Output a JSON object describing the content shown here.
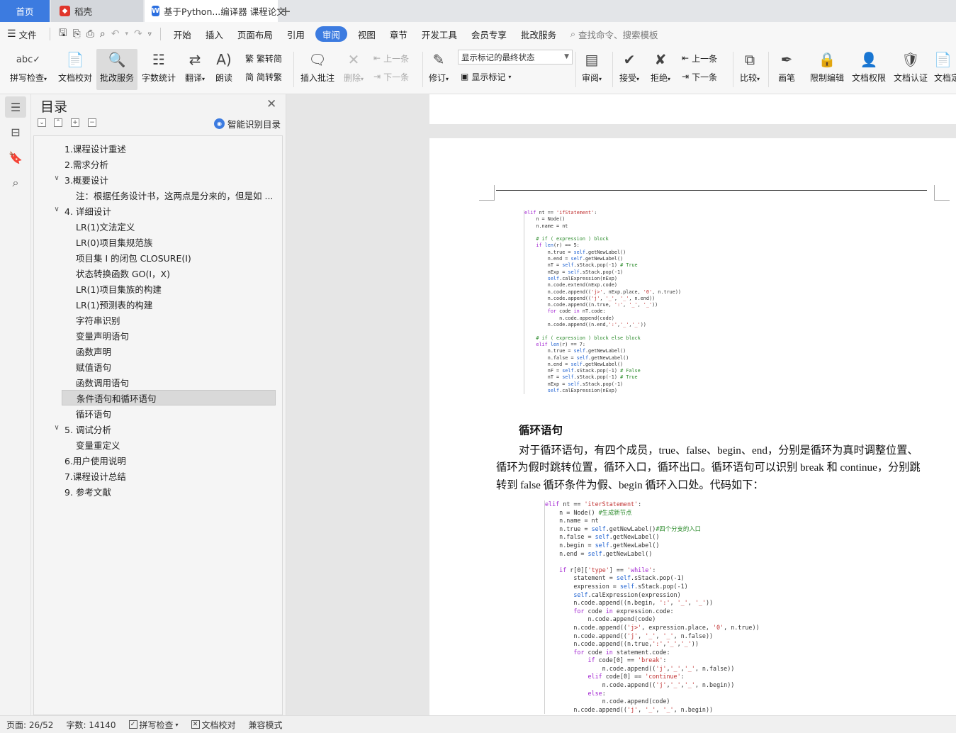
{
  "tabs": {
    "home": "首页",
    "daoke": "稻壳",
    "doc": "基于Python...编译器 课程论文",
    "add": "+"
  },
  "menu": {
    "file": "文件",
    "items": [
      "开始",
      "插入",
      "页面布局",
      "引用",
      "审阅",
      "视图",
      "章节",
      "开发工具",
      "会员专享",
      "批改服务"
    ],
    "active": "审阅",
    "search": "查找命令、搜索模板"
  },
  "ribbon": {
    "spell": "拼写检查",
    "proof": "文档校对",
    "correct": "批改服务",
    "wordcount": "字数统计",
    "translate": "翻译",
    "read": "朗读",
    "trad": "繁转简",
    "simp": "简转繁",
    "insert_comment": "插入批注",
    "delete": "删除",
    "prev_c": "上一条",
    "next_c": "下一条",
    "revise": "修订",
    "markup_state": "显示标记的最终状态",
    "show_markup": "显示标记",
    "review": "审阅",
    "accept": "接受",
    "reject": "拒绝",
    "prev": "上一条",
    "next": "下一条",
    "compare": "比较",
    "pen": "画笔",
    "restrict": "限制编辑",
    "doc_perm": "文档权限",
    "doc_cert": "文档认证",
    "doc_more": "文档定"
  },
  "nav": {
    "title": "目录",
    "smart": "智能识别目录",
    "items": [
      {
        "text": "1.课程设计重述",
        "level": 1,
        "arrow": ""
      },
      {
        "text": "2.需求分析",
        "level": 1,
        "arrow": ""
      },
      {
        "text": "3.概要设计",
        "level": 1,
        "arrow": "∨"
      },
      {
        "text": "注：根据任务设计书，这两点是分来的，但是如 ...",
        "level": 2,
        "arrow": ""
      },
      {
        "text": "4. 详细设计",
        "level": 1,
        "arrow": "∨"
      },
      {
        "text": "LR(1)文法定义",
        "level": 2,
        "arrow": ""
      },
      {
        "text": "LR(0)项目集规范族",
        "level": 2,
        "arrow": ""
      },
      {
        "text": "项目集 I 的闭包 CLOSURE(I)",
        "level": 2,
        "arrow": ""
      },
      {
        "text": "状态转换函数 GO(I，X)",
        "level": 2,
        "arrow": ""
      },
      {
        "text": "LR(1)项目集族的构建",
        "level": 2,
        "arrow": ""
      },
      {
        "text": "LR(1)预测表的构建",
        "level": 2,
        "arrow": ""
      },
      {
        "text": "字符串识别",
        "level": 2,
        "arrow": ""
      },
      {
        "text": "变量声明语句",
        "level": 2,
        "arrow": ""
      },
      {
        "text": "函数声明",
        "level": 2,
        "arrow": ""
      },
      {
        "text": "赋值语句",
        "level": 2,
        "arrow": ""
      },
      {
        "text": "函数调用语句",
        "level": 2,
        "arrow": ""
      },
      {
        "text": "条件语句和循环语句",
        "level": 2,
        "arrow": "",
        "selected": true
      },
      {
        "text": "循环语句",
        "level": 2,
        "arrow": ""
      },
      {
        "text": "5. 调试分析",
        "level": 1,
        "arrow": "∨"
      },
      {
        "text": "变量重定义",
        "level": 2,
        "arrow": ""
      },
      {
        "text": "6.用户使用说明",
        "level": 1,
        "arrow": ""
      },
      {
        "text": "7.课程设计总结",
        "level": 1,
        "arrow": ""
      },
      {
        "text": "9. 参考文献",
        "level": 1,
        "arrow": ""
      }
    ]
  },
  "document": {
    "heading": "循环语句",
    "paragraph": "对于循环语句，有四个成员，true、false、begin、end，分别是循环为真时调整位置、循环为假时跳转位置，循环入口，循环出口。循环语句可以识别 break 和 continue，分别跳转到 false 循环条件为假、begin 循环入口处。代码如下：",
    "code1": [
      "elif nt == 'ifStatement':",
      "    n = Node()",
      "    n.name = nt",
      "",
      "    # if ( expression ) block",
      "    if len(r) == 5:",
      "        n.true = self.getNewLabel()",
      "        n.end = self.getNewLabel()",
      "        nT = self.sStack.pop(-1) # True",
      "        nExp = self.sStack.pop(-1)",
      "        self.calExpression(nExp)",
      "        n.code.extend(nExp.code)",
      "        n.code.append(('j>', nExp.place, '0', n.true))",
      "        n.code.append(('j', '_', '_', n.end))",
      "        n.code.append((n.true, ':', '_', '_'))",
      "        for code in nT.code:",
      "            n.code.append(code)",
      "        n.code.append((n.end,':','_','_'))",
      "",
      "    # if ( expression ) block else block",
      "    elif len(r) == 7:",
      "        n.true = self.getNewLabel()",
      "        n.false = self.getNewLabel()",
      "        n.end = self.getNewLabel()",
      "        nF = self.sStack.pop(-1) # False",
      "        nT = self.sStack.pop(-1) # True",
      "        nExp = self.sStack.pop(-1)",
      "        self.calExpression(nExp)"
    ],
    "code2": [
      "elif nt == 'iterStatement':",
      "    n = Node() #生成新节点",
      "    n.name = nt",
      "    n.true = self.getNewLabel()#四个分支的入口",
      "    n.false = self.getNewLabel()",
      "    n.begin = self.getNewLabel()",
      "    n.end = self.getNewLabel()",
      "",
      "    if r[0]['type'] == 'while':",
      "        statement = self.sStack.pop(-1)",
      "        expression = self.sStack.pop(-1)",
      "        self.calExpression(expression)",
      "        n.code.append((n.begin, ':', '_', '_'))",
      "        for code in expression.code:",
      "            n.code.append(code)",
      "        n.code.append(('j>', expression.place, '0', n.true))",
      "        n.code.append(('j', '_', '_', n.false))",
      "        n.code.append((n.true,':','_','_'))",
      "        for code in statement.code:",
      "            if code[0] == 'break':",
      "                n.code.append(('j','_','_', n.false))",
      "            elif code[0] == 'continue':",
      "                n.code.append(('j','_','_', n.begin))",
      "            else:",
      "                n.code.append(code)",
      "        n.code.append(('j', '_', '_', n.begin))"
    ]
  },
  "status": {
    "page": "页面: 26/52",
    "words": "字数: 14140",
    "spell": "拼写检查",
    "proof": "文档校对",
    "compat": "兼容模式"
  }
}
